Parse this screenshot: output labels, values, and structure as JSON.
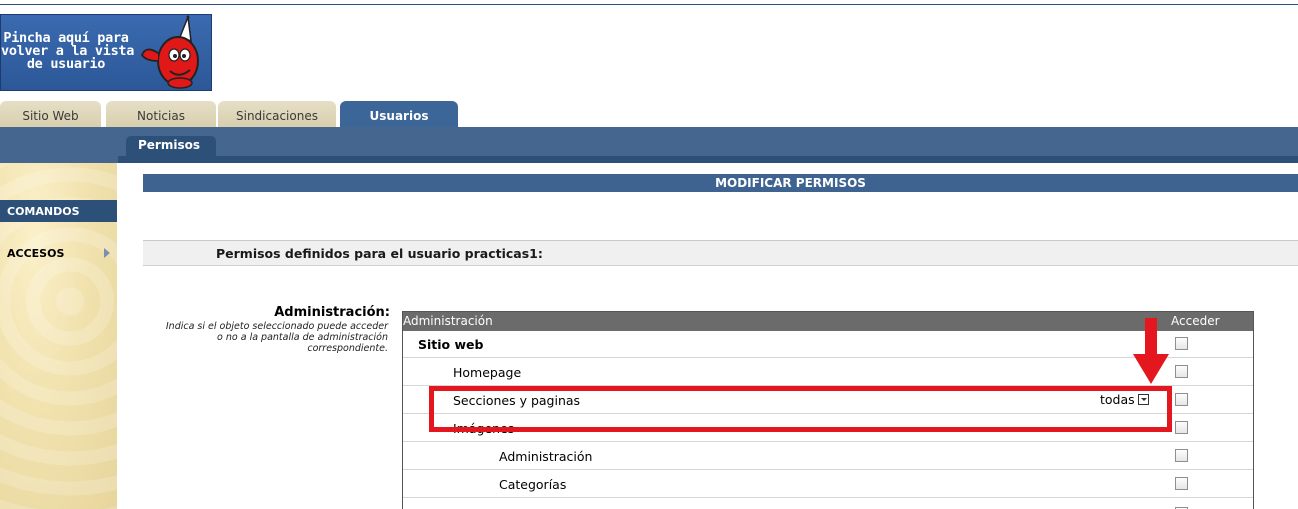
{
  "banner": {
    "text": "Pincha aquí para\nvolver a la vista\nde usuario"
  },
  "tabs": [
    {
      "label": "Sitio Web",
      "active": false
    },
    {
      "label": "Noticias",
      "active": false
    },
    {
      "label": "Sindicaciones",
      "active": false
    },
    {
      "label": "Usuarios",
      "active": true
    }
  ],
  "subtab": {
    "label": "Permisos"
  },
  "sidebar": {
    "header": "COMANDOS",
    "items": [
      {
        "label": "ACCESOS"
      }
    ]
  },
  "main": {
    "title": "MODIFICAR PERMISOS",
    "permissions_header": "Permisos definidos para el usuario practicas1:"
  },
  "admin_section": {
    "label": "Administración:",
    "description": "Indica si el objeto seleccionado puede acceder o no a la pantalla de administración correspondiente."
  },
  "table": {
    "columns": [
      "Administración",
      "Acceder"
    ],
    "rows": [
      {
        "label": "Sitio web",
        "level": 0,
        "bold": true,
        "checked": false
      },
      {
        "label": "Homepage",
        "level": 1,
        "bold": false,
        "checked": false
      },
      {
        "label": "Secciones y paginas",
        "level": 1,
        "bold": false,
        "checked": false,
        "select_value": "todas"
      },
      {
        "label": "Imágenes",
        "level": 1,
        "bold": false,
        "checked": false
      },
      {
        "label": "Administración",
        "level": 2,
        "bold": false,
        "checked": false
      },
      {
        "label": "Categorías",
        "level": 2,
        "bold": false,
        "checked": false
      }
    ]
  },
  "colors": {
    "primary_blue": "#44668f",
    "dark_blue": "#2d5079",
    "highlight_red": "#e4171f",
    "tab_beige": "#e6dfc6",
    "sidebar_bg": "#f1e2ae"
  },
  "icons": [
    "mascot-logo",
    "chevron-right-icon",
    "dropdown-arrow-icon",
    "down-arrow-annotation"
  ]
}
